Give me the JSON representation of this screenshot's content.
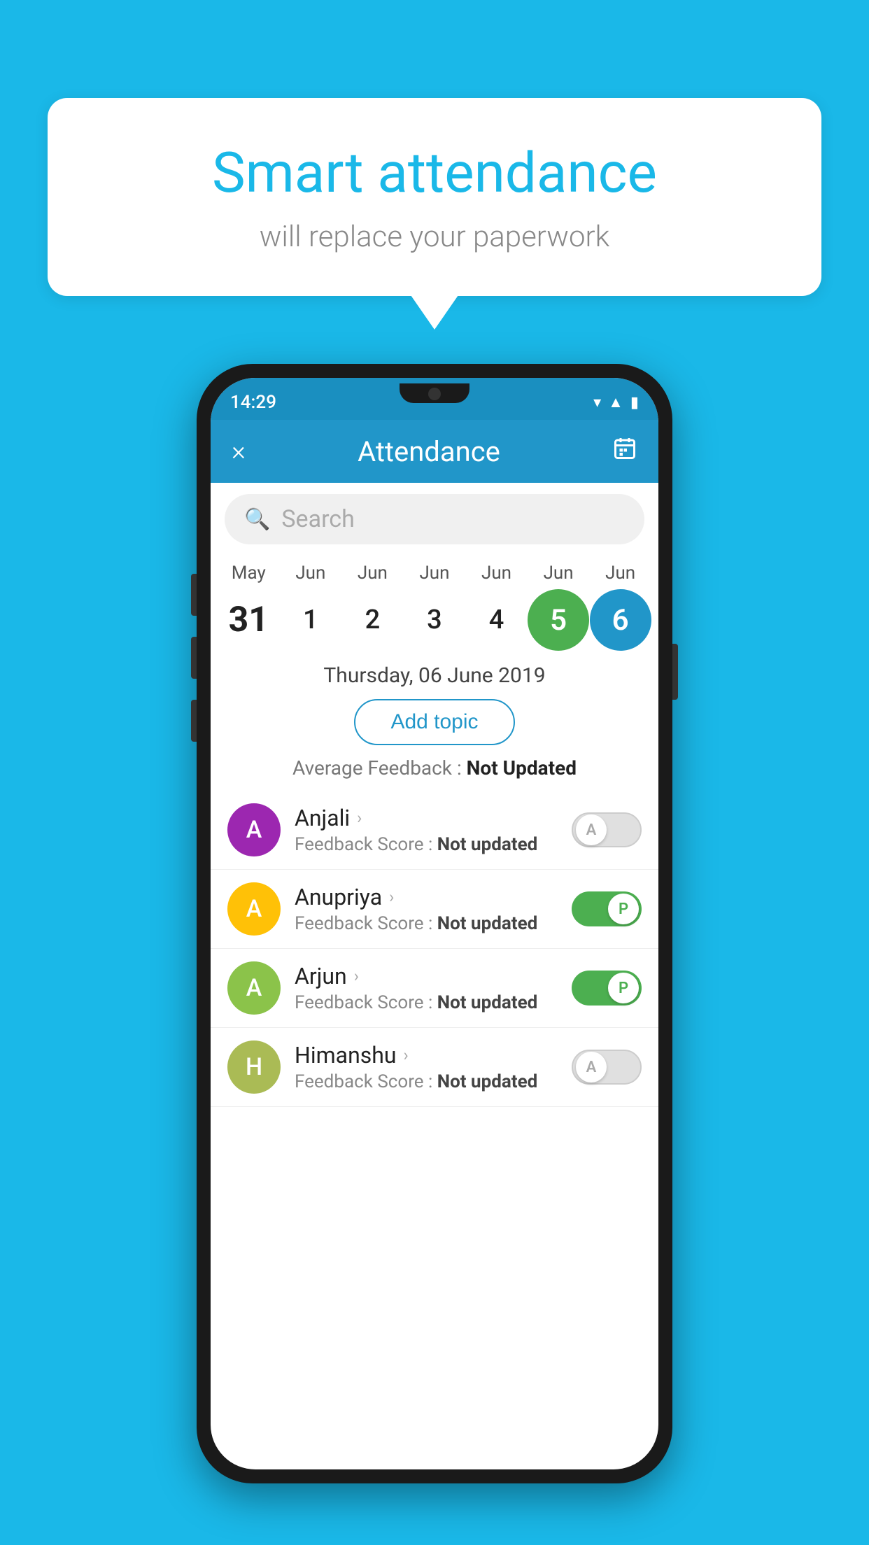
{
  "background_color": "#1ab8e8",
  "speech_bubble": {
    "title": "Smart attendance",
    "subtitle": "will replace your paperwork"
  },
  "status_bar": {
    "time": "14:29",
    "icons": [
      "wifi",
      "signal",
      "battery"
    ]
  },
  "app_bar": {
    "close_label": "×",
    "title": "Attendance",
    "calendar_icon": "📅"
  },
  "search": {
    "placeholder": "Search"
  },
  "calendar": {
    "months": [
      "May",
      "Jun",
      "Jun",
      "Jun",
      "Jun",
      "Jun",
      "Jun"
    ],
    "dates": [
      "31",
      "1",
      "2",
      "3",
      "4",
      "5",
      "6"
    ],
    "selected_date": 5,
    "today_date": 6,
    "full_date": "Thursday, 06 June 2019"
  },
  "add_topic": {
    "label": "Add topic"
  },
  "avg_feedback": {
    "label": "Average Feedback : ",
    "value": "Not Updated"
  },
  "students": [
    {
      "name": "Anjali",
      "avatar_letter": "A",
      "avatar_color": "#9c27b0",
      "feedback_label": "Feedback Score : ",
      "feedback_value": "Not updated",
      "toggle_state": "off",
      "toggle_letter": "A"
    },
    {
      "name": "Anupriya",
      "avatar_letter": "A",
      "avatar_color": "#ffc107",
      "feedback_label": "Feedback Score : ",
      "feedback_value": "Not updated",
      "toggle_state": "on",
      "toggle_letter": "P"
    },
    {
      "name": "Arjun",
      "avatar_letter": "A",
      "avatar_color": "#8bc34a",
      "feedback_label": "Feedback Score : ",
      "feedback_value": "Not updated",
      "toggle_state": "on",
      "toggle_letter": "P"
    },
    {
      "name": "Himanshu",
      "avatar_letter": "H",
      "avatar_color": "#aabb55",
      "feedback_label": "Feedback Score : ",
      "feedback_value": "Not updated",
      "toggle_state": "off",
      "toggle_letter": "A"
    }
  ]
}
